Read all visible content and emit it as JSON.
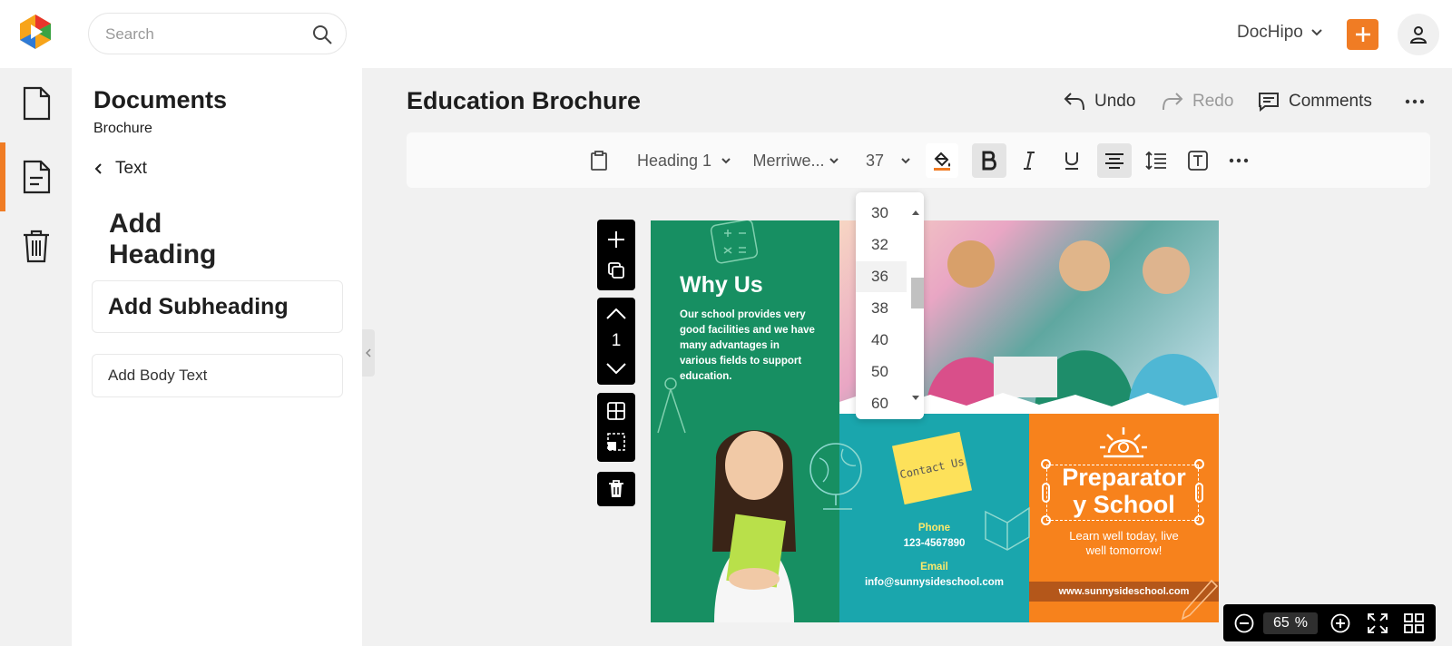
{
  "app": {
    "search_placeholder": "Search",
    "account_name": "DocHipo"
  },
  "colors": {
    "accent": "#f07c24",
    "green": "#178f62",
    "teal": "#1aa6ad",
    "orange": "#f7821c"
  },
  "rail": {
    "items": [
      "document-icon",
      "text-document-icon",
      "trash-icon"
    ],
    "active_index": 1
  },
  "panel": {
    "title": "Documents",
    "subtitle": "Brochure",
    "back_label": "Text",
    "add_heading": "Add Heading",
    "add_subheading": "Add Subheading",
    "add_body": "Add Body Text"
  },
  "document": {
    "title": "Education Brochure"
  },
  "header": {
    "undo": "Undo",
    "redo": "Redo",
    "comments": "Comments"
  },
  "toolbar": {
    "style": "Heading 1",
    "font": "Merriwe...",
    "size": "37"
  },
  "size_dropdown": {
    "options": [
      "30",
      "32",
      "36",
      "38",
      "40",
      "50",
      "60"
    ],
    "highlighted": "36"
  },
  "page_tools": {
    "page_number": "1"
  },
  "brochure": {
    "why_title": "Why Us",
    "why_text": "Our school provides very good facilities and we have many advantages in various fields to support education.",
    "note": "Contact Us",
    "phone_label": "Phone",
    "phone_value": "123-4567890",
    "email_label": "Email",
    "email_value": "info@sunnysideschool.com",
    "school_line1": "Preparator",
    "school_line2": "y School",
    "tagline_line1": "Learn well today, live",
    "tagline_line2": "well tomorrow!",
    "website": "www.sunnysideschool.com"
  },
  "zoom": {
    "value": "65",
    "unit": "%"
  }
}
